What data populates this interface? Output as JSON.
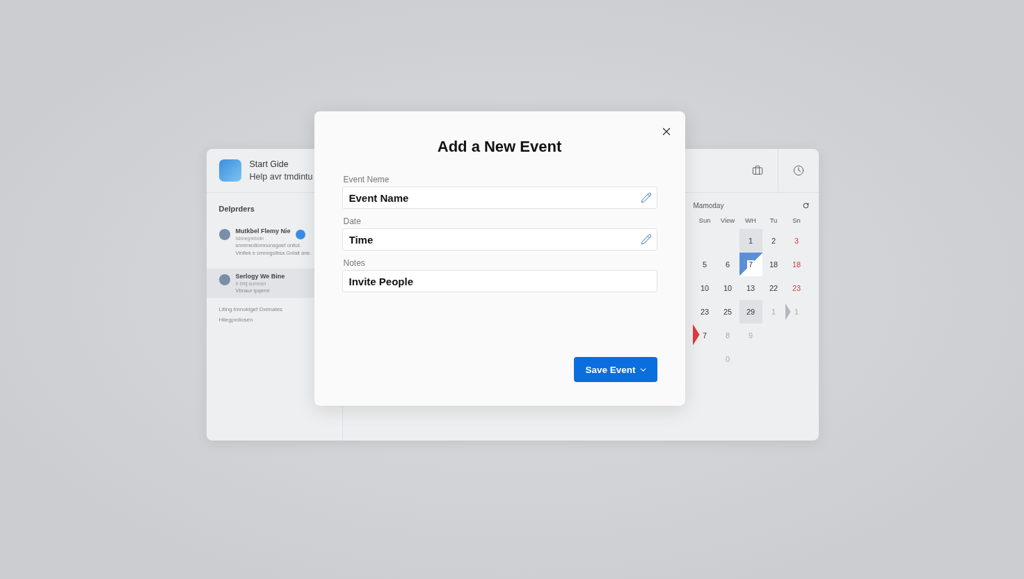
{
  "window": {
    "app_title": "Start Gide",
    "app_subtitle": "Help avr tmdintu",
    "section_title": "Delprders",
    "sidebar_items": [
      {
        "name": "Mutkbel Flemy Nie",
        "sub": "Isbnegrebidn",
        "lines": [
          "snmrnedlomnonsgoef onitol.",
          "Vinfiek e cmnngslbsa Gnlait ane."
        ],
        "badge": true,
        "selected": false
      },
      {
        "name": "Serlogy We Bine",
        "sub": "Ir bhlj sumnsn",
        "lines": [
          "Vbnaur ipqemr"
        ],
        "badge": false,
        "selected": true
      }
    ],
    "sidebar_notes": [
      "Liting tmnokigef Dximates",
      "Hilegprdiosen"
    ],
    "calendar": {
      "title": "Mamoday",
      "weekdays": [
        "Sun",
        "View",
        "WH",
        "Tu",
        "Sn"
      ],
      "rows": [
        [
          {
            "text": ""
          },
          {
            "text": ""
          },
          {
            "text": "1",
            "weekend": false,
            "muted": false,
            "selected": false,
            "highlighted": true,
            "flag": false,
            "arrow": false
          },
          {
            "text": "2",
            "weekend": false,
            "muted": false,
            "selected": false,
            "highlighted": false,
            "flag": false,
            "arrow": false
          },
          {
            "text": "3",
            "weekend": true,
            "muted": false,
            "selected": false,
            "highlighted": false,
            "flag": false,
            "arrow": false
          }
        ],
        [
          {
            "text": "5",
            "weekend": false,
            "muted": false,
            "selected": false,
            "highlighted": false,
            "flag": false,
            "arrow": false
          },
          {
            "text": "6",
            "weekend": false,
            "muted": false,
            "selected": false,
            "highlighted": false,
            "flag": false,
            "arrow": false
          },
          {
            "text": "7",
            "weekend": false,
            "muted": false,
            "selected": true,
            "highlighted": false,
            "flag": false,
            "arrow": false
          },
          {
            "text": "18",
            "weekend": false,
            "muted": false,
            "selected": false,
            "highlighted": false,
            "flag": false,
            "arrow": false
          },
          {
            "text": "18",
            "weekend": true,
            "muted": false,
            "selected": false,
            "highlighted": false,
            "flag": false,
            "arrow": false
          }
        ],
        [
          {
            "text": "10",
            "weekend": false,
            "muted": false,
            "selected": false,
            "highlighted": false,
            "flag": false,
            "arrow": false
          },
          {
            "text": "10",
            "weekend": false,
            "muted": false,
            "selected": false,
            "highlighted": false,
            "flag": false,
            "arrow": false
          },
          {
            "text": "13",
            "weekend": false,
            "muted": false,
            "selected": false,
            "highlighted": false,
            "flag": false,
            "arrow": false
          },
          {
            "text": "22",
            "weekend": false,
            "muted": false,
            "selected": false,
            "highlighted": false,
            "flag": false,
            "arrow": false
          },
          {
            "text": "23",
            "weekend": true,
            "muted": false,
            "selected": false,
            "highlighted": false,
            "flag": false,
            "arrow": false
          }
        ],
        [
          {
            "text": "23",
            "weekend": false,
            "muted": false,
            "selected": false,
            "highlighted": false,
            "flag": false,
            "arrow": false
          },
          {
            "text": "25",
            "weekend": false,
            "muted": false,
            "selected": false,
            "highlighted": false,
            "flag": false,
            "arrow": false
          },
          {
            "text": "29",
            "weekend": false,
            "muted": false,
            "selected": false,
            "highlighted": true,
            "flag": false,
            "arrow": false
          },
          {
            "text": "1",
            "weekend": false,
            "muted": true,
            "selected": false,
            "highlighted": false,
            "flag": false,
            "arrow": false
          },
          {
            "text": "1",
            "weekend": false,
            "muted": true,
            "selected": false,
            "highlighted": false,
            "flag": false,
            "arrow": true
          }
        ],
        [
          {
            "text": "7",
            "weekend": false,
            "muted": false,
            "selected": false,
            "highlighted": false,
            "flag": true,
            "arrow": false
          },
          {
            "text": "8",
            "weekend": false,
            "muted": true,
            "selected": false,
            "highlighted": false,
            "flag": false,
            "arrow": false
          },
          {
            "text": "9",
            "weekend": false,
            "muted": true,
            "selected": false,
            "highlighted": false,
            "flag": false,
            "arrow": false
          },
          {
            "text": ""
          },
          {
            "text": ""
          }
        ],
        [
          {
            "text": ""
          },
          {
            "text": "0",
            "weekend": false,
            "muted": true,
            "selected": false,
            "highlighted": false,
            "flag": false,
            "arrow": false
          },
          {
            "text": ""
          },
          {
            "text": ""
          },
          {
            "text": ""
          }
        ]
      ]
    }
  },
  "dialog": {
    "title": "Add a New Event",
    "fields": [
      {
        "label": "Event Neme",
        "value": "Event Name",
        "pencil": true
      },
      {
        "label": "Date",
        "value": "Time",
        "pencil": true
      },
      {
        "label": "Notes",
        "value": "Invite People",
        "pencil": false
      }
    ],
    "save_button": "Save Event"
  }
}
